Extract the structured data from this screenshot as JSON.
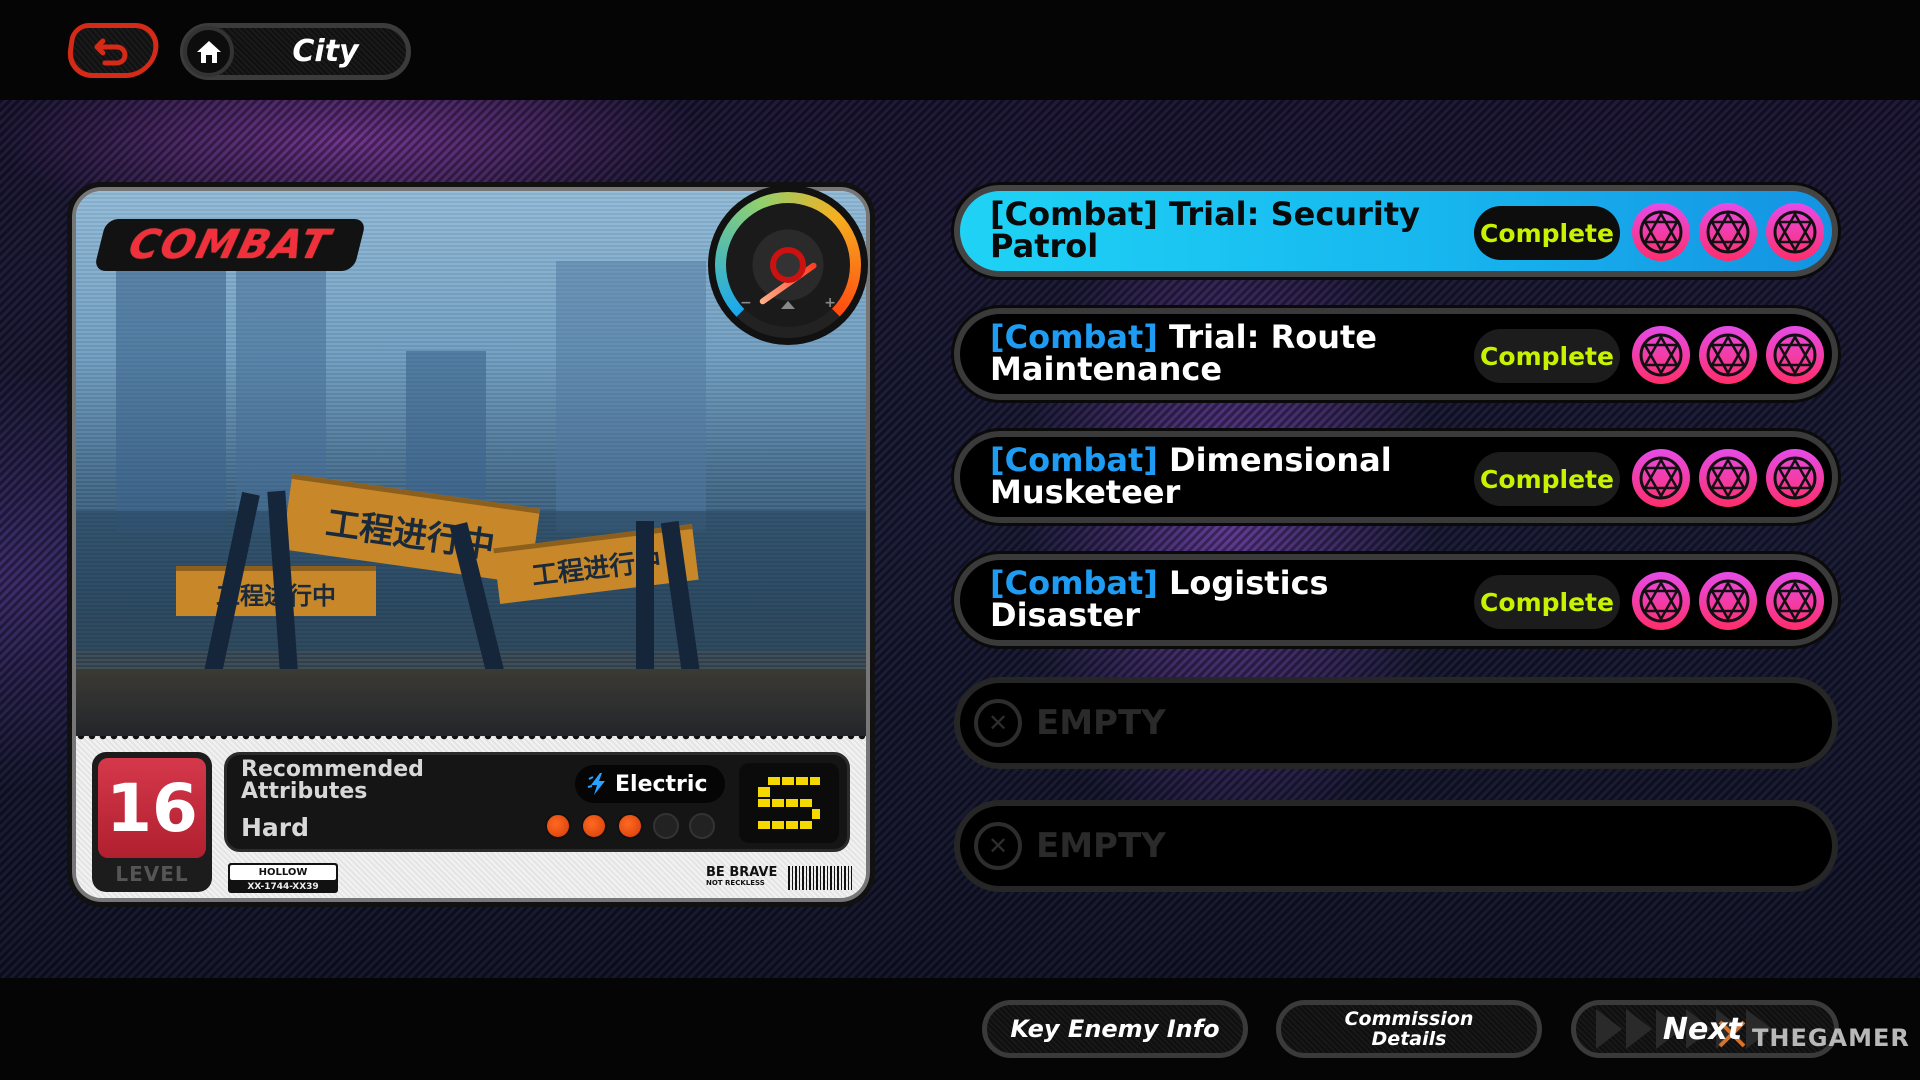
{
  "topbar": {
    "back_icon": "back-arrow-icon",
    "home_icon": "home-icon",
    "location": "City"
  },
  "commission": {
    "category_badge": "COMBAT",
    "difficulty_gauge_icon": "difficulty-gauge-icon",
    "scene_signs": [
      "工程进行中",
      "工程进行中",
      "工程进行中"
    ],
    "level": "16",
    "level_label": "LEVEL",
    "recommended_label": "Recommended Attributes",
    "element_icon": "electric-bolt-icon",
    "element": "Electric",
    "difficulty": "Hard",
    "difficulty_pips": {
      "filled": 3,
      "total": 5
    },
    "rank": "S",
    "plate_top": "HOLLOW",
    "plate_bottom": "XX-1744-XX39",
    "motto_line1": "BE BRAVE",
    "motto_line2": "NOT RECKLESS"
  },
  "missions": [
    {
      "tag": "[Combat]",
      "title": "Trial: Security Patrol",
      "status": "Complete",
      "medals": 3,
      "selected": true
    },
    {
      "tag": "[Combat]",
      "title": "Trial: Route Maintenance",
      "status": "Complete",
      "medals": 3,
      "selected": false
    },
    {
      "tag": "[Combat]",
      "title": "Dimensional Musketeer",
      "status": "Complete",
      "medals": 3,
      "selected": false
    },
    {
      "tag": "[Combat]",
      "title": "Logistics Disaster",
      "status": "Complete",
      "medals": 3,
      "selected": false
    }
  ],
  "empty_slots": [
    {
      "label": "EMPTY",
      "icon": "x-circle-icon"
    },
    {
      "label": "EMPTY",
      "icon": "x-circle-icon"
    }
  ],
  "bottombar": {
    "key_enemy": "Key Enemy Info",
    "commission_details_line1": "Commission",
    "commission_details_line2": "Details",
    "next": "Next"
  },
  "watermark": "THEGAMER",
  "colors": {
    "accent_blue": "#1e9bf2",
    "selected_row": "#1fd3f5",
    "complete_text": "#c7f200",
    "combat_red": "#f0303c",
    "level_red": "#d5384b",
    "pip_on": "#ff6a20",
    "rank_yellow": "#f5d800",
    "medal_pink": "#ff2d6a"
  }
}
